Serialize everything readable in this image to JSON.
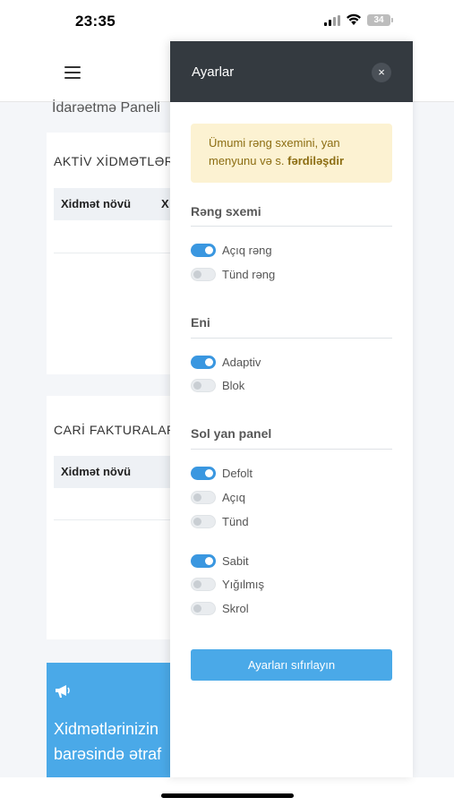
{
  "status_bar": {
    "time": "23:35",
    "battery": "34"
  },
  "background": {
    "page_title": "İdarəetmə Paneli",
    "cards": [
      {
        "title": "AKTİV XİDMƏTLƏR",
        "column_header": "Xidmət növü",
        "column_header_2": "X"
      },
      {
        "title": "CARİ FAKTURALAR",
        "column_header": "Xidmət növü"
      }
    ],
    "promo": {
      "line1": "Xidmətlərinizin",
      "line2": "barəsində ətraf"
    }
  },
  "drawer": {
    "title": "Ayarlar",
    "close_label": "×",
    "alert": {
      "text": "Ümumi rəng sxemini, yan menyunu və s. ",
      "bold": "fərdiləşdir"
    },
    "sections": {
      "color_scheme": {
        "title": "Rəng sxemi",
        "options": [
          {
            "label": "Açıq rəng",
            "on": true
          },
          {
            "label": "Tünd rəng",
            "on": false
          }
        ]
      },
      "width": {
        "title": "Eni",
        "options": [
          {
            "label": "Adaptiv",
            "on": true
          },
          {
            "label": "Blok",
            "on": false
          }
        ]
      },
      "sidebar": {
        "title": "Sol yan panel",
        "theme_options": [
          {
            "label": "Defolt",
            "on": true
          },
          {
            "label": "Açıq",
            "on": false
          },
          {
            "label": "Tünd",
            "on": false
          }
        ],
        "mode_options": [
          {
            "label": "Sabit",
            "on": true
          },
          {
            "label": "Yığılmış",
            "on": false
          },
          {
            "label": "Skrol",
            "on": false
          }
        ]
      }
    },
    "reset_button": "Ayarları sıfırlayın"
  }
}
